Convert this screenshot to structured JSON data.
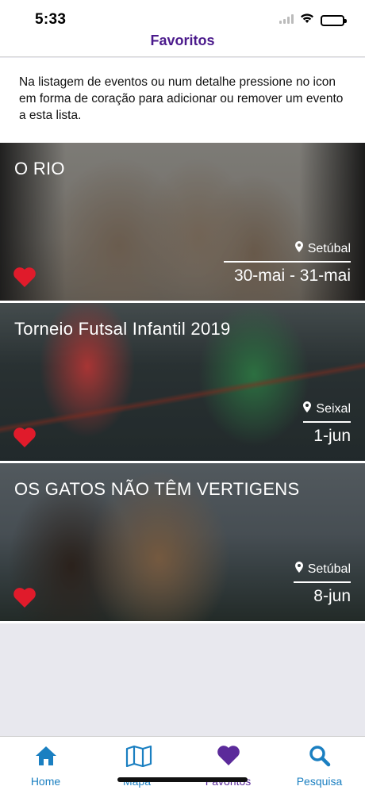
{
  "status_bar": {
    "time": "5:33"
  },
  "header": {
    "title": "Favoritos"
  },
  "intro_text": "Na listagem de eventos ou num detalhe pressione no icon em forma de coração para adicionar ou remover um evento a esta lista.",
  "events": [
    {
      "title": "O RIO",
      "location": "Setúbal",
      "date": "30-mai - 31-mai",
      "favorite": true
    },
    {
      "title": "Torneio Futsal Infantil 2019",
      "location": "Seixal",
      "date": "1-jun",
      "favorite": true
    },
    {
      "title": "OS GATOS NÃO TÊM VERTIGENS",
      "location": "Setúbal",
      "date": "8-jun",
      "favorite": true
    }
  ],
  "tabs": [
    {
      "label": "Home",
      "icon": "home-icon",
      "active": false
    },
    {
      "label": "Mapa",
      "icon": "map-icon",
      "active": false
    },
    {
      "label": "Favoritos",
      "icon": "heart-icon",
      "active": true
    },
    {
      "label": "Pesquisa",
      "icon": "search-icon",
      "active": false
    }
  ],
  "colors": {
    "accent": "#4b1a8c",
    "tab_blue": "#1a7fc1",
    "heart_red": "#e01b2b"
  }
}
